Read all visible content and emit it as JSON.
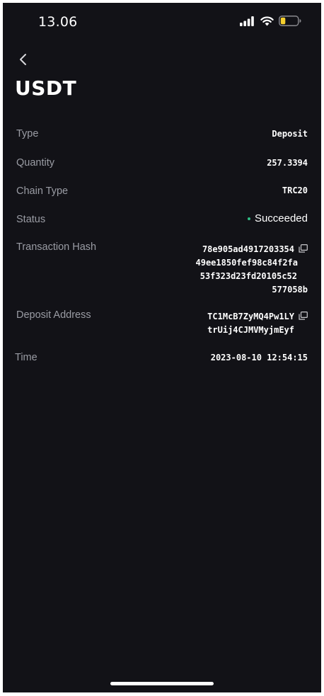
{
  "status_bar": {
    "time": "13.06",
    "icons": [
      "signal-icon",
      "wifi-icon",
      "battery-icon"
    ],
    "battery_color": "#f5d02e"
  },
  "nav": {
    "back_icon": "chevron-left-icon"
  },
  "title": "USDT",
  "details": {
    "type_label": "Type",
    "type_value": "Deposit",
    "quantity_label": "Quantity",
    "quantity_value": "257.3394",
    "chain_type_label": "Chain Type",
    "chain_type_value": "TRC20",
    "status_label": "Status",
    "status_value": "Succeeded",
    "status_color": "#2ebd85",
    "tx_hash_label": "Transaction Hash",
    "tx_hash_lines": [
      "78e905ad4917203354",
      "49ee1850fef98c84f2fa",
      "53f323d23fd20105c52",
      "577058b"
    ],
    "deposit_address_label": "Deposit Address",
    "deposit_address_lines": [
      "TC1McB7ZyMQ4Pw1LY",
      "trUij4CJMVMyjmEyf"
    ],
    "time_label": "Time",
    "time_value": "2023-08-10 12:54:15"
  },
  "colors": {
    "background": "#121217",
    "label": "#9a9ca4",
    "value": "#ffffff"
  }
}
